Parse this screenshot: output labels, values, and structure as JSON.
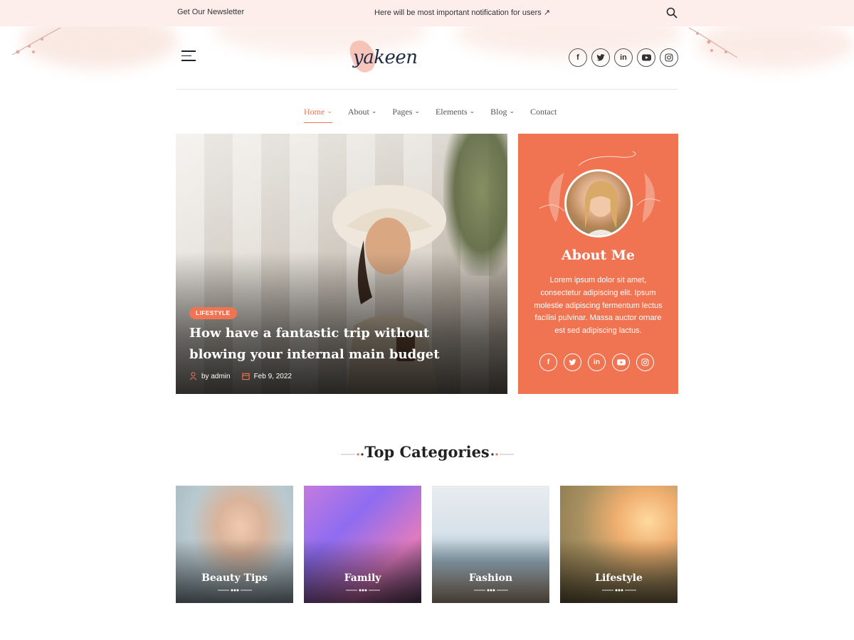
{
  "topbar": {
    "newsletter": "Get Our Newsletter",
    "notice": "Here will be most important notification for users ↗"
  },
  "brand": {
    "logo_text": "yakeen"
  },
  "social": [
    "facebook-icon",
    "twitter-icon",
    "linkedin-icon",
    "youtube-icon",
    "instagram-icon"
  ],
  "nav": {
    "items": [
      {
        "label": "Home",
        "dropdown": true,
        "active": true
      },
      {
        "label": "About",
        "dropdown": true
      },
      {
        "label": "Pages",
        "dropdown": true
      },
      {
        "label": "Elements",
        "dropdown": true
      },
      {
        "label": "Blog",
        "dropdown": true
      },
      {
        "label": "Contact",
        "dropdown": false
      }
    ]
  },
  "hero": {
    "badge": "LIFESTYLE",
    "title": "How have a fantastic trip without blowing your internal main budget",
    "author": "by admin",
    "date": "Feb 9, 2022"
  },
  "about": {
    "title": "About Me",
    "text": "Lorem ipsum dolor sit amet, consectetur adipiscing elit. Ipsum molestie adipiscing fermentum lectus facilisi pulvinar. Massa auctor ornare est sed adipiscing lactus."
  },
  "categories": {
    "title": "Top Categories",
    "items": [
      {
        "label": "Beauty Tips"
      },
      {
        "label": "Family"
      },
      {
        "label": "Fashion"
      },
      {
        "label": "Lifestyle"
      }
    ]
  },
  "colors": {
    "accent": "#f07352",
    "topbar": "#fdeeec",
    "text": "#222222"
  }
}
